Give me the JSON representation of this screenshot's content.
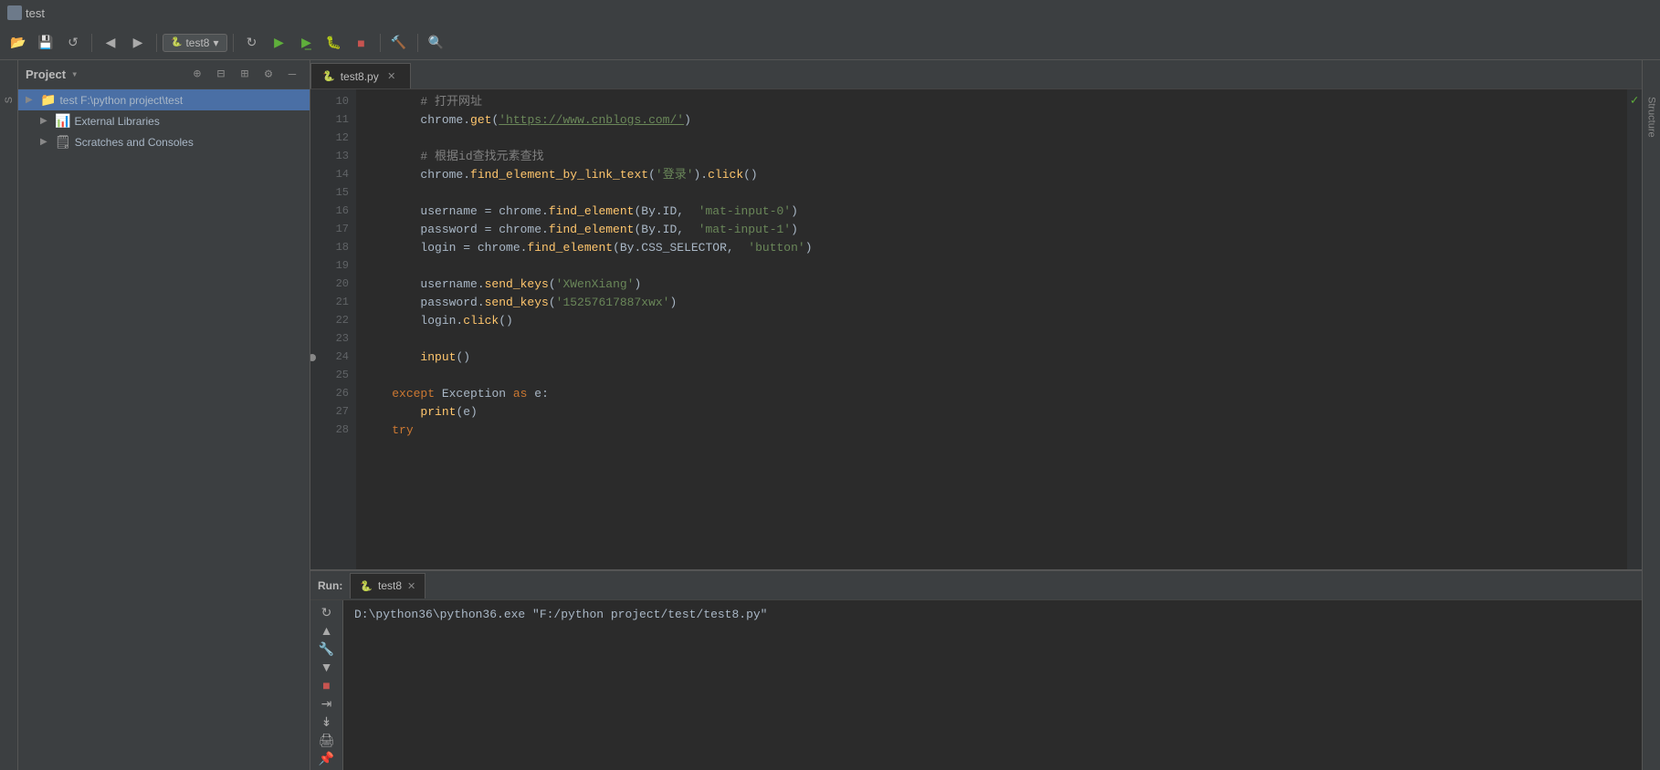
{
  "titleBar": {
    "icon": "📁",
    "text": "test"
  },
  "toolbar": {
    "backBtn": "◀",
    "forwardBtn": "▶",
    "runConfig": "test8",
    "rerunBtn": "↻",
    "runBtn": "▶",
    "stopBtn": "■",
    "buildBtn": "🔨",
    "searchBtn": "🔍",
    "syncBtn": "⟳",
    "addBtn": "+",
    "checkBtn": "✓",
    "settingsBtn": "⚙"
  },
  "projectPanel": {
    "title": "Project",
    "items": [
      {
        "label": "test  F:\\python project\\test",
        "type": "folder",
        "level": 0,
        "expanded": true
      },
      {
        "label": "External Libraries",
        "type": "lib",
        "level": 1
      },
      {
        "label": "Scratches and Consoles",
        "type": "scratch",
        "level": 1
      }
    ]
  },
  "editor": {
    "tabName": "test8.py",
    "lines": [
      {
        "num": 10,
        "content": "        # 打开网址",
        "type": "comment"
      },
      {
        "num": 11,
        "content": "        chrome.get('https://www.cnblogs.com/')",
        "type": "code"
      },
      {
        "num": 12,
        "content": "",
        "type": "empty"
      },
      {
        "num": 13,
        "content": "        # 根据id查找元素查找",
        "type": "comment"
      },
      {
        "num": 14,
        "content": "        chrome.find_element_by_link_text('登录').click()",
        "type": "code"
      },
      {
        "num": 15,
        "content": "",
        "type": "empty"
      },
      {
        "num": 16,
        "content": "        username = chrome.find_element(By.ID,  'mat-input-0')",
        "type": "code"
      },
      {
        "num": 17,
        "content": "        password = chrome.find_element(By.ID,  'mat-input-1')",
        "type": "code"
      },
      {
        "num": 18,
        "content": "        login = chrome.find_element(By.CSS_SELECTOR,  'button')",
        "type": "code"
      },
      {
        "num": 19,
        "content": "",
        "type": "empty"
      },
      {
        "num": 20,
        "content": "        username.send_keys('XWenXiang')",
        "type": "code"
      },
      {
        "num": 21,
        "content": "        password.send_keys('15257617887xwx')",
        "type": "code"
      },
      {
        "num": 22,
        "content": "        login.click()",
        "type": "code"
      },
      {
        "num": 23,
        "content": "",
        "type": "empty"
      },
      {
        "num": 24,
        "content": "        input()",
        "type": "code",
        "hasMarker": true
      },
      {
        "num": 25,
        "content": "",
        "type": "empty"
      },
      {
        "num": 26,
        "content": "    except Exception as e:",
        "type": "code"
      },
      {
        "num": 27,
        "content": "        print(e)",
        "type": "code"
      },
      {
        "num": 28,
        "content": "    try",
        "type": "code"
      }
    ]
  },
  "bottomPanel": {
    "runLabel": "Run:",
    "tabName": "test8",
    "consoleOutput": "D:\\python36\\python36.exe \"F:/python project/test/test8.py\""
  },
  "leftStrip": {
    "label": "S"
  },
  "rightSidebar": {
    "label": "Structure"
  }
}
